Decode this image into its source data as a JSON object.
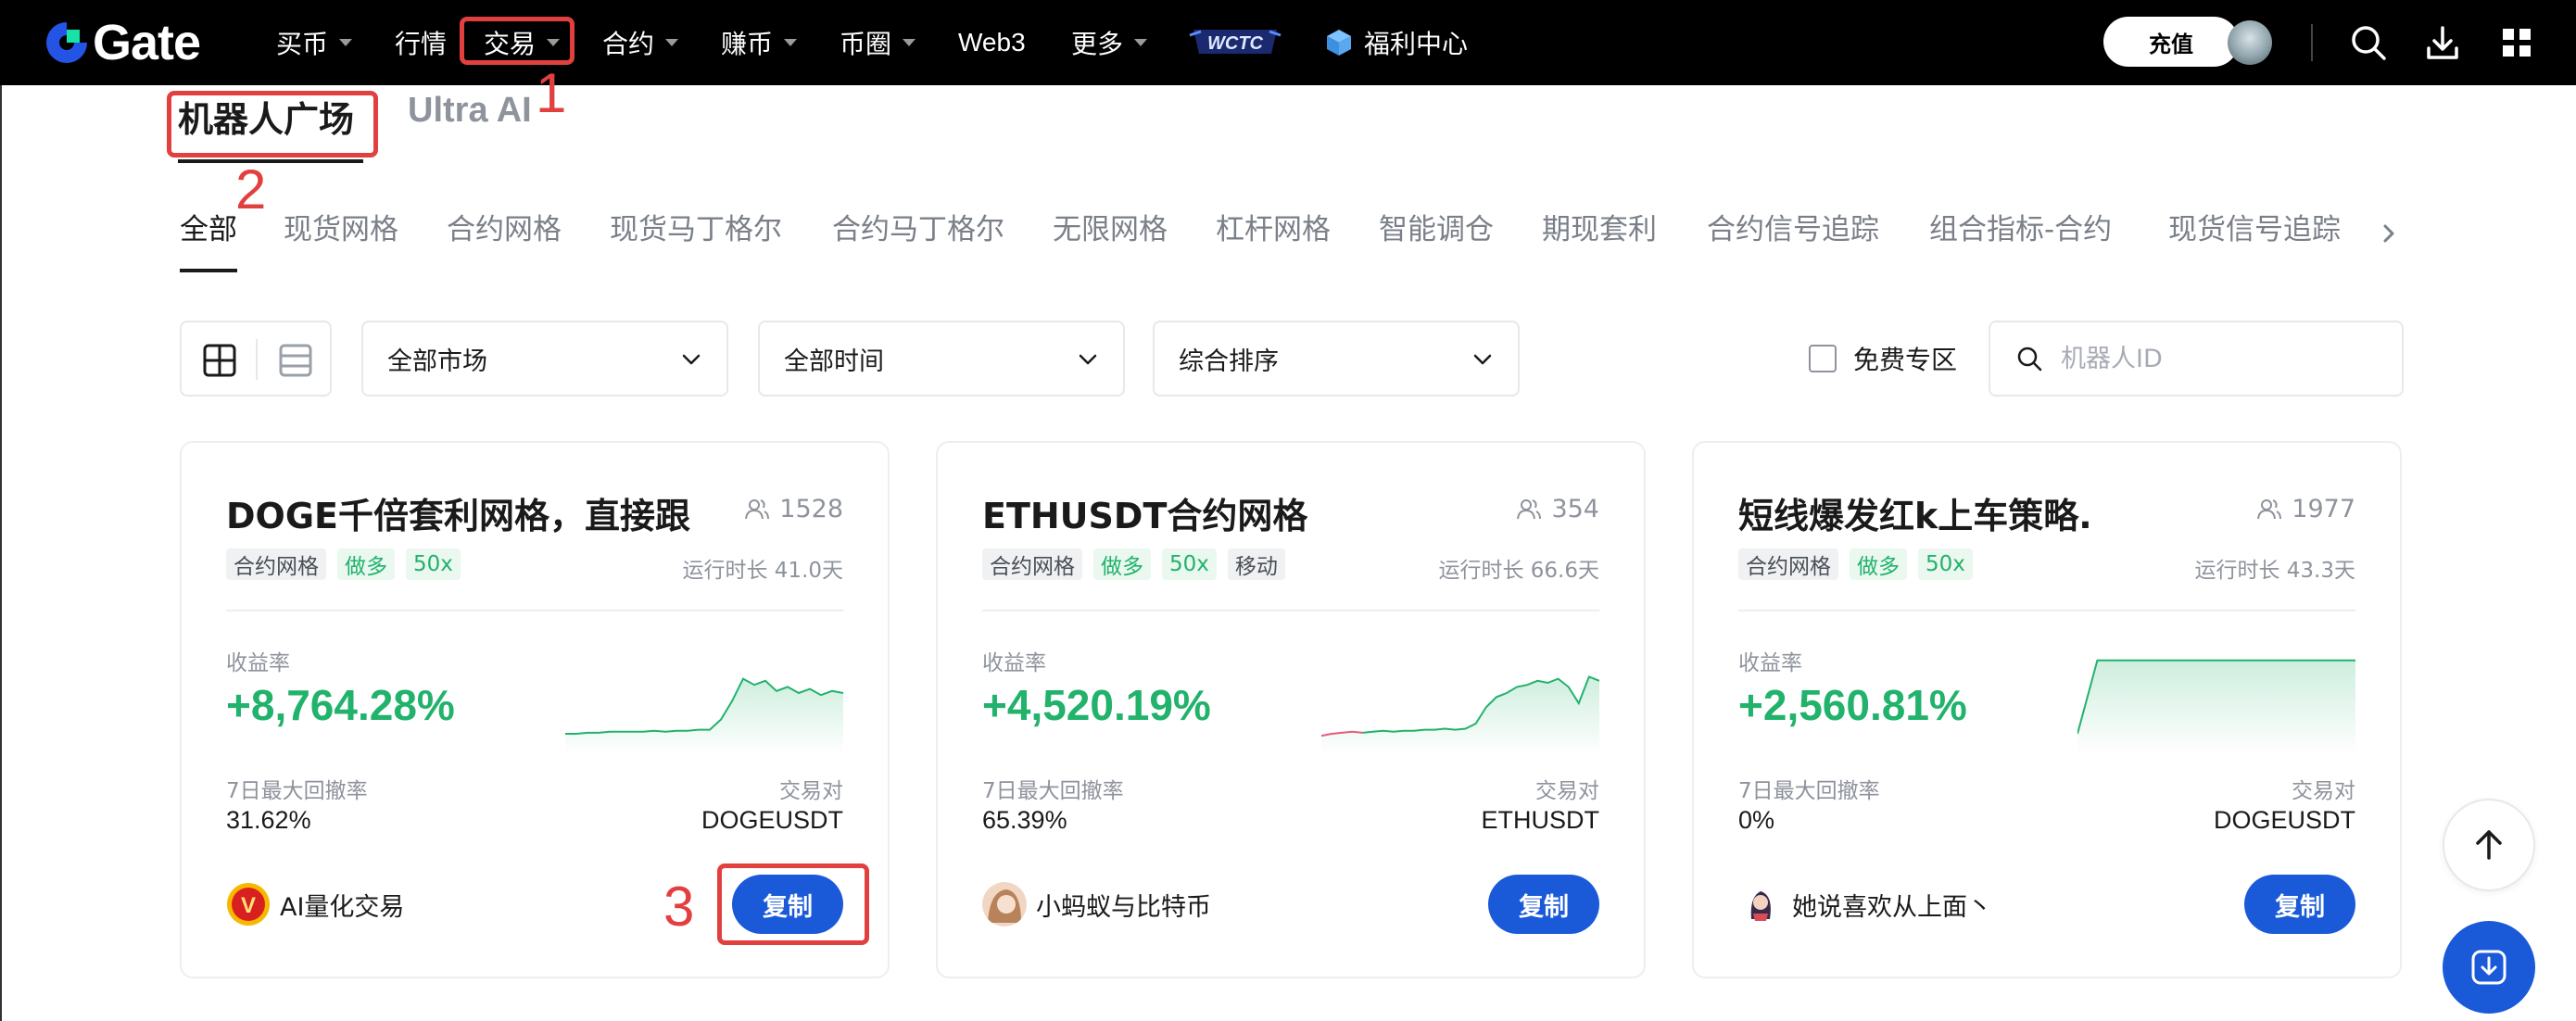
{
  "nav": {
    "brand": "Gate",
    "items": [
      {
        "label": "买币",
        "caret": true
      },
      {
        "label": "行情",
        "caret": false
      },
      {
        "label": "交易",
        "caret": true
      },
      {
        "label": "合约",
        "caret": true
      },
      {
        "label": "赚币",
        "caret": true
      },
      {
        "label": "币圈",
        "caret": true
      },
      {
        "label": "Web3",
        "caret": false
      },
      {
        "label": "更多",
        "caret": true
      }
    ],
    "wctc_logo": "WCTC",
    "welfare": "福利中心",
    "deposit": "充值",
    "icons": [
      "search-icon",
      "download-icon",
      "apps-grid-icon"
    ]
  },
  "tabs": {
    "active": "机器人广场",
    "inactive": "Ultra AI"
  },
  "annotations": [
    "1",
    "2",
    "3"
  ],
  "categories": [
    "全部",
    "现货网格",
    "合约网格",
    "现货马丁格尔",
    "合约马丁格尔",
    "无限网格",
    "杠杆网格",
    "智能调仓",
    "期现套利",
    "合约信号追踪",
    "组合指标-合约",
    "现货信号追踪"
  ],
  "filters": {
    "market": "全部市场",
    "time": "全部时间",
    "sort": "综合排序",
    "free_zone": "免费专区",
    "search_placeholder": "机器人ID"
  },
  "labels": {
    "runtime_prefix": "运行时长",
    "yield": "收益率",
    "drawdown": "7日最大回撤率",
    "pair": "交易对",
    "copy": "复制"
  },
  "cards": [
    {
      "title": "DOGE千倍套利网格，直接跟",
      "followers": "1528",
      "tags": [
        {
          "text": "合约网格",
          "tone": "gray"
        },
        {
          "text": "做多",
          "tone": "green"
        },
        {
          "text": "50x",
          "tone": "green"
        }
      ],
      "runtime": "运行时长 41.0天",
      "yield": "+8,764.28%",
      "drawdown": "31.62%",
      "pair": "DOGEUSDT",
      "creator": "AI量化交易",
      "spark": [
        0.2,
        0.2,
        0.21,
        0.21,
        0.22,
        0.22,
        0.22,
        0.22,
        0.23,
        0.22,
        0.23,
        0.23,
        0.24,
        0.24,
        0.34,
        0.52,
        0.74,
        0.68,
        0.72,
        0.62,
        0.66,
        0.6,
        0.64,
        0.58,
        0.62,
        0.6
      ]
    },
    {
      "title": "ETHUSDT合约网格",
      "followers": "354",
      "tags": [
        {
          "text": "合约网格",
          "tone": "gray"
        },
        {
          "text": "做多",
          "tone": "green"
        },
        {
          "text": "50x",
          "tone": "green"
        },
        {
          "text": "移动",
          "tone": "gray"
        }
      ],
      "runtime": "运行时长 66.6天",
      "yield": "+4,520.19%",
      "drawdown": "65.39%",
      "pair": "ETHUSDT",
      "creator": "小蚂蚁与比特币",
      "spark": [
        0.18,
        0.2,
        0.21,
        0.22,
        0.21,
        0.22,
        0.23,
        0.22,
        0.23,
        0.23,
        0.24,
        0.24,
        0.25,
        0.24,
        0.25,
        0.3,
        0.46,
        0.56,
        0.6,
        0.66,
        0.68,
        0.72,
        0.7,
        0.74,
        0.66,
        0.5,
        0.76,
        0.72
      ]
    },
    {
      "title": "短线爆发红k上车策略.",
      "followers": "1977",
      "tags": [
        {
          "text": "合约网格",
          "tone": "gray"
        },
        {
          "text": "做多",
          "tone": "green"
        },
        {
          "text": "50x",
          "tone": "green"
        }
      ],
      "runtime": "运行时长 43.3天",
      "yield": "+2,560.81%",
      "drawdown": "0%",
      "pair": "DOGEUSDT",
      "creator": "她说喜欢从上面丶",
      "spark": [
        0.2,
        0.92,
        0.92,
        0.92,
        0.92,
        0.92,
        0.92,
        0.92,
        0.92,
        0.92,
        0.92,
        0.92,
        0.92,
        0.92,
        0.92
      ]
    }
  ],
  "colors": {
    "accent_green": "#21b26b",
    "primary_blue": "#1a5ad9",
    "annotation_red": "#e2403f",
    "spark_loss": "#e85a7a"
  }
}
